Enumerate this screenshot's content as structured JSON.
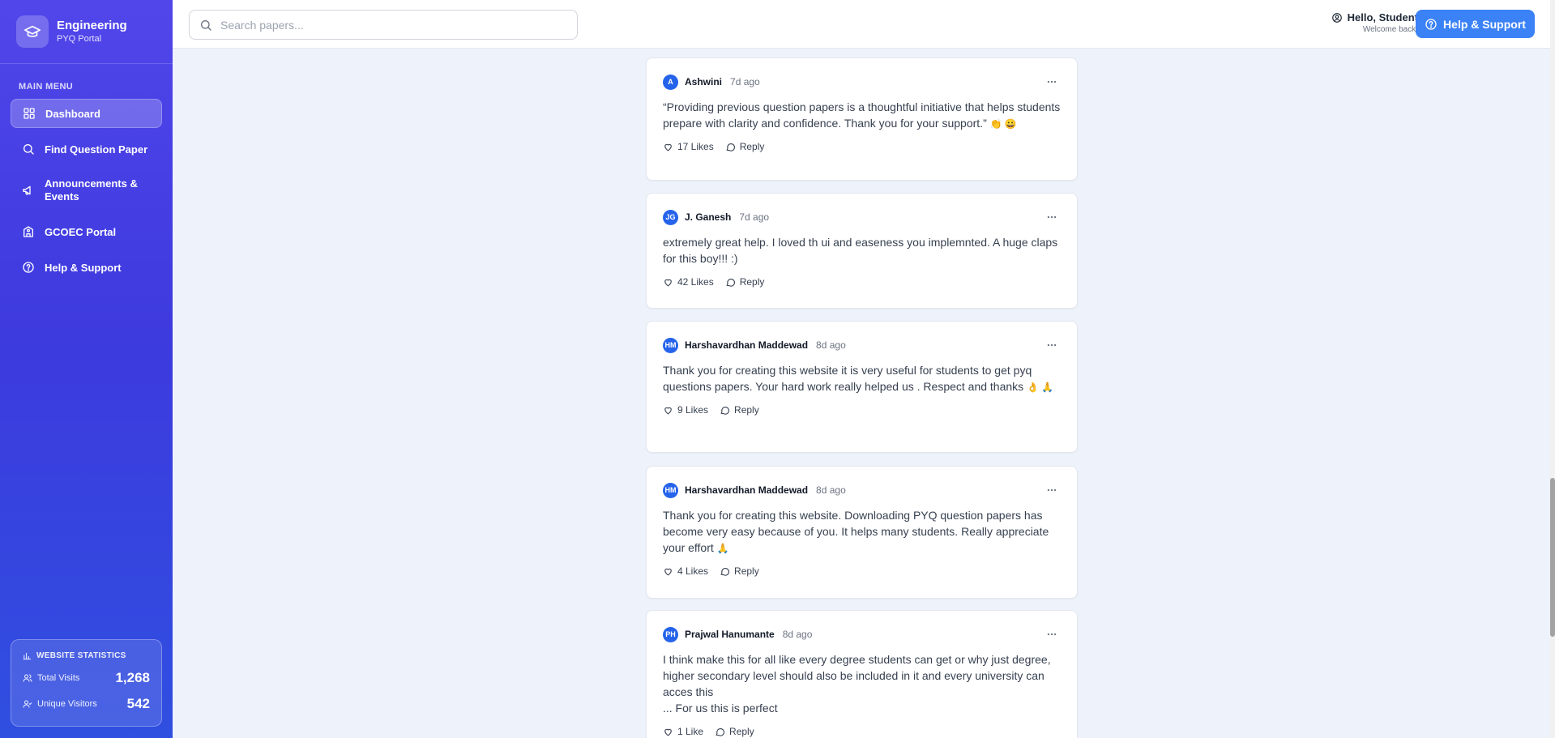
{
  "brand": {
    "title": "Engineering",
    "subtitle": "PYQ Portal"
  },
  "sidebar": {
    "heading": "MAIN MENU",
    "items": [
      {
        "label": "Dashboard",
        "icon": "grid-icon",
        "active": true
      },
      {
        "label": "Find Question Paper",
        "icon": "search-icon"
      },
      {
        "label": "Announcements & Events",
        "icon": "megaphone-icon"
      },
      {
        "label": "GCOEC Portal",
        "icon": "school-icon"
      },
      {
        "label": "Help & Support",
        "icon": "help-circle-icon"
      }
    ]
  },
  "stats": {
    "title": "WEBSITE STATISTICS",
    "total_label": "Total Visits",
    "total_value": "1,268",
    "unique_label": "Unique Visitors",
    "unique_value": "542"
  },
  "header": {
    "search_placeholder": "Search papers...",
    "greeting": "Hello, Student",
    "welcome": "Welcome back!",
    "help_button": "Help & Support"
  },
  "colors": {
    "accent": "#3b82f6",
    "sidebar_top": "#5146ea",
    "sidebar_bottom": "#2f4fe0",
    "avatar": "#2563eb"
  },
  "comments": [
    {
      "initials": "A",
      "name": "Ashwini",
      "time": "7d ago",
      "text": "“Providing previous question papers is a thoughtful initiative that helps students prepare with clarity and confidence. Thank you for your support.”",
      "emoji": "👏 😀",
      "likes": "17 Likes",
      "reply": "Reply"
    },
    {
      "initials": "JG",
      "name": "J. Ganesh",
      "time": "7d ago",
      "text": "extremely great help. I loved th ui and easeness you implemnted. A huge claps for this boy!!! :)",
      "emoji": "",
      "likes": "42 Likes",
      "reply": "Reply"
    },
    {
      "initials": "HM",
      "name": "Harshavardhan Maddewad",
      "time": "8d ago",
      "text": "Thank you for creating this website it is very useful for students to get pyq questions papers. Your hard work really helped us . Respect and thanks",
      "emoji": "👌 🙏",
      "likes": "9 Likes",
      "reply": "Reply"
    },
    {
      "initials": "HM",
      "name": "Harshavardhan Maddewad",
      "time": "8d ago",
      "text": "Thank you for creating this website. Downloading PYQ question papers has become very easy because of you. It helps many students. Really appreciate your effort",
      "emoji": "🙏",
      "likes": "4 Likes",
      "reply": "Reply"
    },
    {
      "initials": "PH",
      "name": "Prajwal Hanumante",
      "time": "8d ago",
      "text": "I think make this for all like every degree students can get or why just degree, higher secondary level should also be included in it and every university can acces this\n... For us this is perfect",
      "emoji": "",
      "likes": "1 Like",
      "reply": "Reply"
    }
  ]
}
